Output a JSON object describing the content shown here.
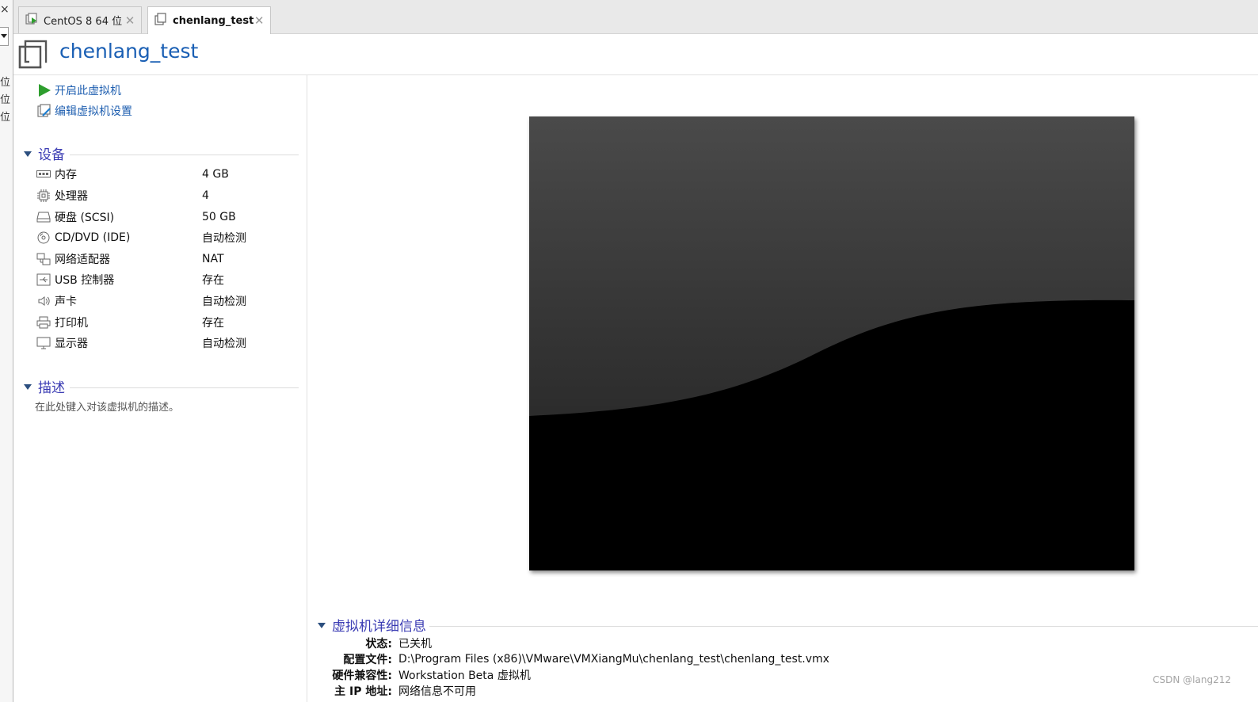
{
  "tabs": [
    {
      "label": "CentOS 8 64 位",
      "active": false,
      "close": "✕"
    },
    {
      "label": "chenlang_test",
      "active": true,
      "close": "✕"
    }
  ],
  "left_edge": {
    "close_glyph": "×",
    "chars": [
      "位",
      "位",
      "位"
    ]
  },
  "header": {
    "title": "chenlang_test"
  },
  "actions": {
    "power_on": "开启此虚拟机",
    "edit_settings": "编辑虚拟机设置"
  },
  "devices_section": {
    "title": "设备",
    "items": [
      {
        "name": "内存",
        "value": "4 GB",
        "icon": "memory-icon"
      },
      {
        "name": "处理器",
        "value": "4",
        "icon": "processor-icon"
      },
      {
        "name": "硬盘 (SCSI)",
        "value": "50 GB",
        "icon": "hard-disk-icon"
      },
      {
        "name": "CD/DVD (IDE)",
        "value": "自动检测",
        "icon": "cd-dvd-icon"
      },
      {
        "name": "网络适配器",
        "value": "NAT",
        "icon": "network-adapter-icon"
      },
      {
        "name": "USB 控制器",
        "value": "存在",
        "icon": "usb-controller-icon"
      },
      {
        "name": "声卡",
        "value": "自动检测",
        "icon": "sound-card-icon"
      },
      {
        "name": "打印机",
        "value": "存在",
        "icon": "printer-icon"
      },
      {
        "name": "显示器",
        "value": "自动检测",
        "icon": "display-icon"
      }
    ]
  },
  "description_section": {
    "title": "描述",
    "placeholder": "在此处键入对该虚拟机的描述。"
  },
  "details_section": {
    "title": "虚拟机详细信息",
    "rows": [
      {
        "key": "状态:",
        "value": "已关机"
      },
      {
        "key": "配置文件:",
        "value": "D:\\Program Files (x86)\\VMware\\VMXiangMu\\chenlang_test\\chenlang_test.vmx"
      },
      {
        "key": "硬件兼容性:",
        "value": "Workstation Beta 虚拟机"
      },
      {
        "key": "主 IP 地址:",
        "value": "网络信息不可用"
      }
    ]
  },
  "watermark": "CSDN @lang212",
  "colors": {
    "accent_title": "#1a5fb4",
    "section_title": "#3a3bb3",
    "power_green": "#2e9e2e"
  }
}
